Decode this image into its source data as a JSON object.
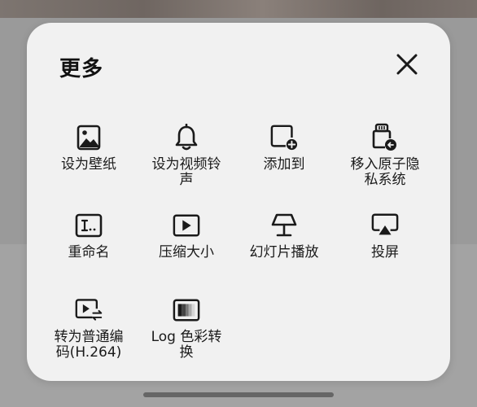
{
  "sheet": {
    "title": "更多",
    "close_icon": "close-icon"
  },
  "actions": [
    {
      "icon": "image-icon",
      "label": "设为壁纸"
    },
    {
      "icon": "bell-icon",
      "label": "设为视频铃声"
    },
    {
      "icon": "add-to-album-icon",
      "label": "添加到"
    },
    {
      "icon": "private-lock-icon",
      "label": "移入原子隐私系统"
    },
    {
      "icon": "rename-icon",
      "label": "重命名"
    },
    {
      "icon": "video-compress-icon",
      "label": "压缩大小"
    },
    {
      "icon": "slideshow-lamp-icon",
      "label": "幻灯片播放"
    },
    {
      "icon": "cast-screen-icon",
      "label": "投屏"
    },
    {
      "icon": "video-convert-icon",
      "label": "转为普通编码(H.264)"
    },
    {
      "icon": "log-color-icon",
      "label": "Log 色彩转换"
    }
  ]
}
